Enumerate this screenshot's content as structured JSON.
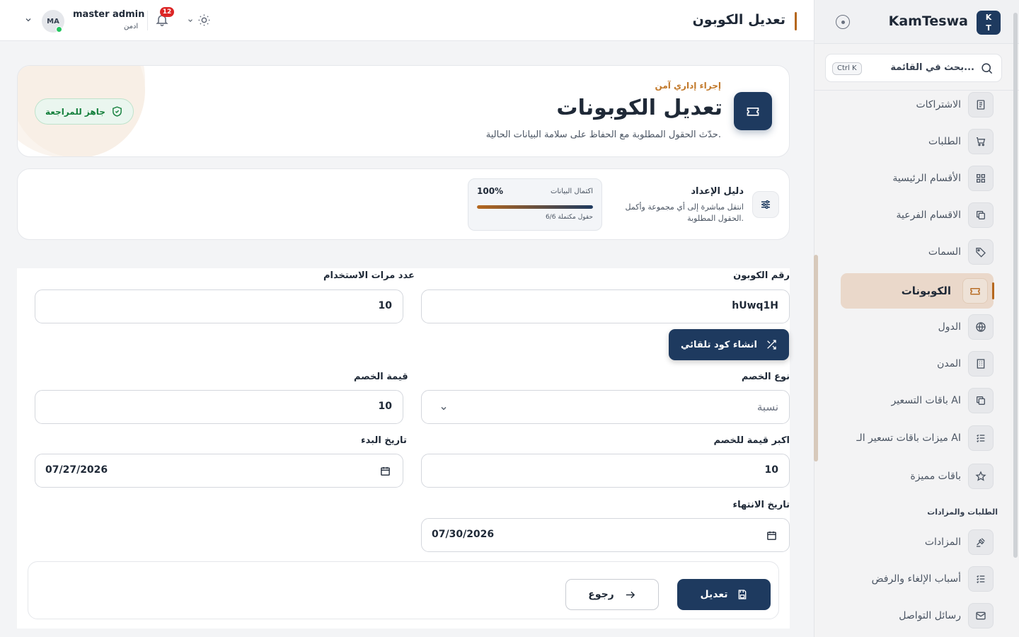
{
  "brand": {
    "name": "KamTeswa",
    "logo_line1": "K",
    "logo_line2": "T"
  },
  "sidebar": {
    "search_placeholder": "بحث في القائمة...",
    "search_shortcut": "Ctrl K",
    "items": [
      {
        "label": "الاشتراكات",
        "icon": "receipt-icon"
      },
      {
        "label": "الطلبات",
        "icon": "cart-icon"
      },
      {
        "label": "الأقسام الرئيسية",
        "icon": "grid-icon"
      },
      {
        "label": "الاقسام الفرعية",
        "icon": "copy-icon"
      },
      {
        "label": "السمات",
        "icon": "tag-icon"
      },
      {
        "label": "الكوبونات",
        "icon": "ticket-icon",
        "active": true
      },
      {
        "label": "الدول",
        "icon": "globe-icon"
      },
      {
        "label": "المدن",
        "icon": "building-icon"
      },
      {
        "label": "باقات التسعير AI",
        "icon": "copy-icon"
      },
      {
        "label": "ميزات باقات تسعير الـ AI",
        "icon": "list-check-icon"
      },
      {
        "label": "باقات مميزة",
        "icon": "star-icon"
      },
      {
        "label": "المزادات",
        "icon": "gavel-icon"
      },
      {
        "label": "أسباب الإلغاء والرفض",
        "icon": "list-check-icon"
      },
      {
        "label": "رسائل التواصل",
        "icon": "mail-icon"
      }
    ],
    "section_orders": "الطلبات والمزادات"
  },
  "header": {
    "title": "تعديل الكوبون",
    "user_name": "master admin",
    "user_role": "ادمن",
    "avatar_initials": "MA",
    "notifications": "12"
  },
  "hero": {
    "kicker": "إجراء إداري آمن",
    "title": "تعديل الكوبونات",
    "subtitle": "حدّث الحقول المطلوبة مع الحفاظ على سلامة البيانات الحالية.",
    "status": "جاهز للمراجعة"
  },
  "guide": {
    "title": "دليل الإعداد",
    "description": "انتقل مباشرة إلى أي مجموعة وأكمل الحقول المطلوبة.",
    "progress_label": "اكتمال البيانات",
    "progress_pct": "100%",
    "progress_value": 1.0,
    "progress_count": "6/6 حقول مكتملة"
  },
  "form": {
    "coupon_code_label": "رقم الكوبون",
    "coupon_code_value": "hUwq1H",
    "generate_label": "انشاء كود تلقائي",
    "usage_count_label": "عدد مرات الاستخدام",
    "usage_count_value": "10",
    "discount_type_label": "نوع الخصم",
    "discount_type_value": "نسبة",
    "discount_value_label": "قيمة الخصم",
    "discount_value_value": "10",
    "max_discount_label": "اكبر قيمة للخصم",
    "max_discount_value": "10",
    "start_date_label": "تاريخ البدء",
    "start_date_value": "07/27/2026",
    "end_date_label": "تاريخ الانتهاء",
    "end_date_value": "07/30/2026"
  },
  "actions": {
    "save_label": "تعديل",
    "back_label": "رجوع"
  },
  "colors": {
    "primary": "#1e3a5f",
    "accent": "#b5671d",
    "success": "#15803d",
    "danger": "#dc2626"
  }
}
